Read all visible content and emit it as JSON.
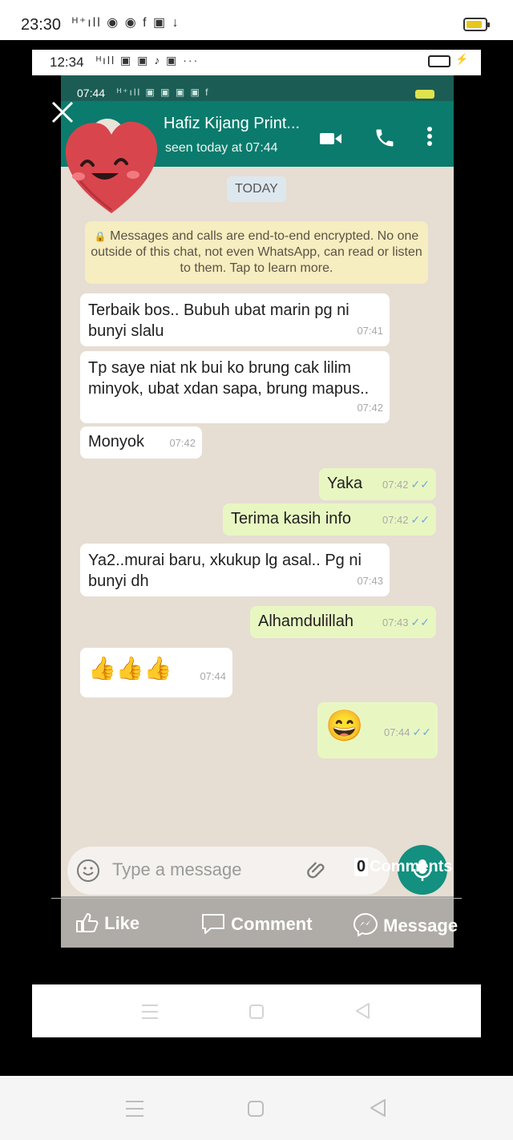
{
  "outer_status": {
    "time": "23:30",
    "icons": "ᴴ⁺ıll ◉ ◉ f ▣ ↓"
  },
  "mid_status": {
    "time": "12:34",
    "icons": "ᴴıll ▣ ▣ ♪ ▣ ···"
  },
  "wa_status": {
    "time": "07:44",
    "icons": "ᴴ⁺ıll ▣ ▣ ▣ ▣ f"
  },
  "chat": {
    "contact_name": "Hafiz Kijang Print...",
    "last_seen": "seen today at 07:44",
    "date_chip": "TODAY",
    "encryption_notice": "Messages and calls are end-to-end encrypted. No one outside of this chat, not even WhatsApp, can read or listen to them. Tap to learn more.",
    "messages": [
      {
        "text": "Terbaik bos.. Bubuh ubat marin pg ni bunyi slalu",
        "time": "07:41",
        "dir": "in"
      },
      {
        "text": "Tp saye niat nk bui ko brung cak lilim minyok, ubat xdan sapa, brung mapus..",
        "time": "07:42",
        "dir": "in"
      },
      {
        "text": "Monyok",
        "time": "07:42",
        "dir": "in"
      },
      {
        "text": "Yaka",
        "time": "07:42",
        "dir": "out"
      },
      {
        "text": "Terima kasih info",
        "time": "07:42",
        "dir": "out"
      },
      {
        "text": "Ya2..murai baru, xkukup lg asal.. Pg ni bunyi dh",
        "time": "07:43",
        "dir": "in"
      },
      {
        "text": "Alhamdulillah",
        "time": "07:43",
        "dir": "out"
      },
      {
        "text": "👍👍👍",
        "time": "07:44",
        "dir": "in"
      },
      {
        "text": "😄",
        "time": "07:44",
        "dir": "out"
      }
    ],
    "input_placeholder": "Type a message",
    "ticks": "✓✓"
  },
  "facebook": {
    "comments_count": "0",
    "comments_label": "Comments",
    "like_label": "Like",
    "comment_label": "Comment",
    "message_label": "Message"
  },
  "colors": {
    "wa_header": "#0a7b6d",
    "wa_status": "#1b5d55",
    "outgoing_bubble": "#e8f7c2",
    "incoming_bubble": "#ffffff",
    "chat_bg": "#e6ddd3",
    "fab": "#13907f"
  }
}
